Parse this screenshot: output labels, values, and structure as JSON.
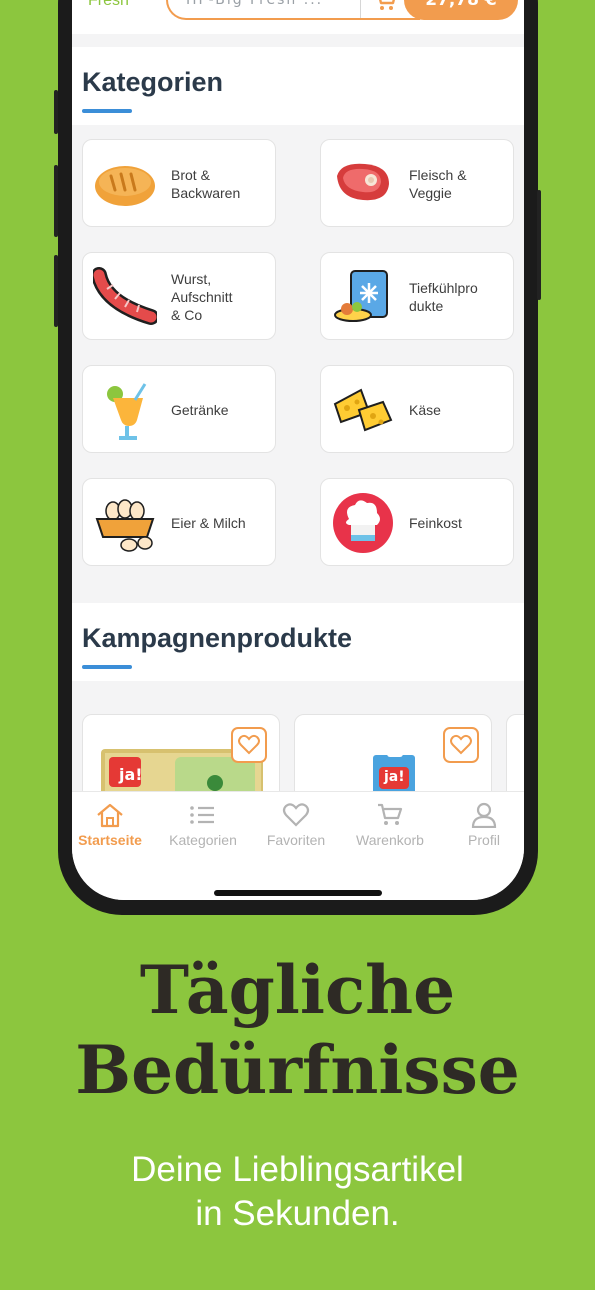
{
  "header": {
    "brand": "Fresh",
    "search_placeholder": "HP-Big Fresh ...",
    "cart_total": "27,78 €"
  },
  "sections": {
    "categories_title": "Kategorien",
    "campaign_title": "Kampagnenprodukte"
  },
  "categories": [
    {
      "label": "Brot &\nBackwaren",
      "icon": "bread-icon"
    },
    {
      "label": "Fleisch &\nVeggie",
      "icon": "steak-icon"
    },
    {
      "label": "Wurst,\nAufschnitt\n& Co",
      "icon": "sausage-icon"
    },
    {
      "label": "Tiefkühlpro\ndukte",
      "icon": "frozen-food-icon"
    },
    {
      "label": "Getränke",
      "icon": "drink-icon"
    },
    {
      "label": "Käse",
      "icon": "cheese-icon"
    },
    {
      "label": "Eier & Milch",
      "icon": "eggs-icon"
    },
    {
      "label": "Feinkost",
      "icon": "chef-hat-icon"
    }
  ],
  "products": [
    {
      "brand": "ja!",
      "icon": "butter-product-image"
    },
    {
      "brand": "ja!",
      "icon": "milk-product-image"
    }
  ],
  "tabs": [
    {
      "label": "Startseite",
      "icon": "home-icon",
      "active": true
    },
    {
      "label": "Kategorien",
      "icon": "list-icon",
      "active": false
    },
    {
      "label": "Favoriten",
      "icon": "heart-icon",
      "active": false
    },
    {
      "label": "Warenkorb",
      "icon": "cart-icon",
      "active": false
    },
    {
      "label": "Profil",
      "icon": "profile-icon",
      "active": false
    }
  ],
  "promo": {
    "headline": "Tägliche\nBedürfnisse",
    "subline": "Deine Lieblingsartikel\nin Sekunden."
  },
  "colors": {
    "background": "#8cc63e",
    "accent": "#f29c4e",
    "title": "#2b3a4a",
    "underline": "#3b8ed8"
  }
}
